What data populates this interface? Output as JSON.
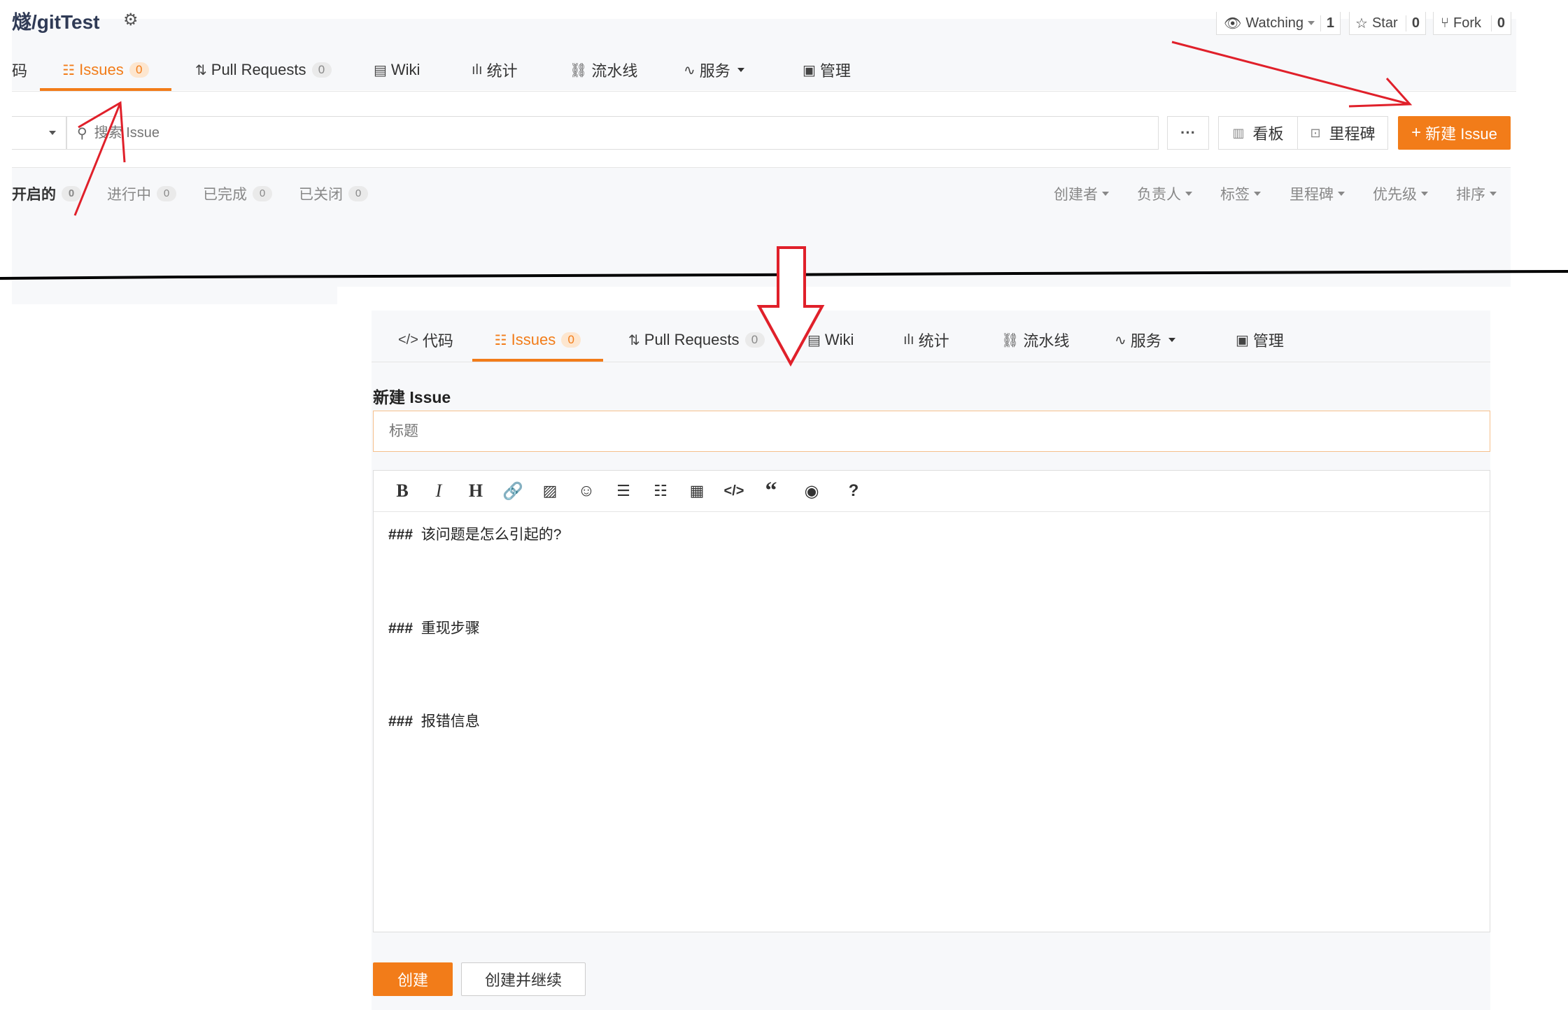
{
  "top": {
    "repo_title": "燧/gitTest",
    "tabs": {
      "left_fragment": "码",
      "issues": "Issues",
      "issues_count": "0",
      "pulls": "Pull Requests",
      "pulls_count": "0",
      "wiki": "Wiki",
      "stats": "统计",
      "pipeline": "流水线",
      "services": "服务",
      "manage": "管理"
    },
    "repo_buttons": {
      "watching": "Watching",
      "watching_count": "1",
      "star": "Star",
      "star_count": "0",
      "fork": "Fork",
      "fork_count": "0"
    },
    "search_placeholder": "搜索 Issue",
    "more": "···",
    "board": "看板",
    "milestone": "里程碑",
    "new_issue": "新建 Issue",
    "status_filters": [
      {
        "label": "开启的",
        "count": "0"
      },
      {
        "label": "进行中",
        "count": "0"
      },
      {
        "label": "已完成",
        "count": "0"
      },
      {
        "label": "已关闭",
        "count": "0"
      }
    ],
    "dropdowns": [
      "创建者",
      "负责人",
      "标签",
      "里程碑",
      "优先级",
      "排序"
    ]
  },
  "bottom": {
    "tabs": {
      "code": "代码",
      "issues": "Issues",
      "issues_count": "0",
      "pulls": "Pull Requests",
      "pulls_count": "0",
      "wiki": "Wiki",
      "stats": "统计",
      "pipeline": "流水线",
      "services": "服务",
      "manage": "管理"
    },
    "form_title": "新建 Issue",
    "title_placeholder": "标题",
    "toolbar": [
      "bold-icon",
      "italic-icon",
      "heading-icon",
      "link-icon",
      "image-icon",
      "emoji-icon",
      "bullet-list-icon",
      "numbered-list-icon",
      "table-icon",
      "code-icon",
      "quote-icon",
      "preview-icon",
      "help-icon"
    ],
    "editor_lines": [
      {
        "hash": "###",
        "text": "该问题是怎么引起的?"
      },
      {
        "hash": "###",
        "text": "重现步骤"
      },
      {
        "hash": "###",
        "text": "报错信息"
      }
    ],
    "create_button": "创建",
    "create_continue_button": "创建并继续"
  },
  "colors": {
    "accent": "#f27c19",
    "annotation": "#e0202a"
  }
}
